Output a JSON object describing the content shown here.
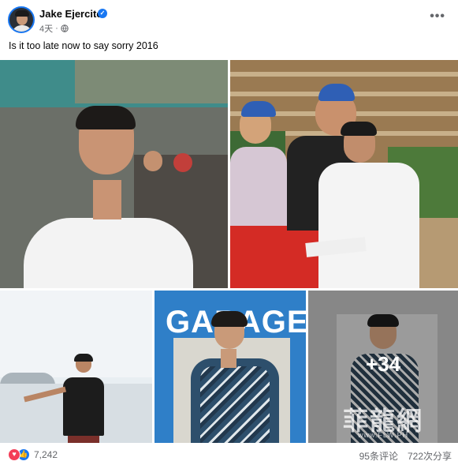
{
  "post": {
    "author": "Jake Ejercito",
    "time": "4天",
    "caption": "Is it too late now to say sorry 2016",
    "more_label": "•••"
  },
  "photos": {
    "magazine_title": "GARAGE",
    "extra_count": "+34",
    "watermark": "菲龍網",
    "watermark_sub": "www.FLW.PH"
  },
  "footer": {
    "reaction_count": "7,242",
    "comments": "95条评论",
    "shares": "722次分享"
  },
  "colors": {
    "accent": "#1877f2",
    "love": "#f33e58",
    "secondary_text": "#65676b"
  },
  "icons": [
    "verified-icon",
    "globe-icon",
    "more-options-icon",
    "love-reaction-icon",
    "like-reaction-icon"
  ]
}
